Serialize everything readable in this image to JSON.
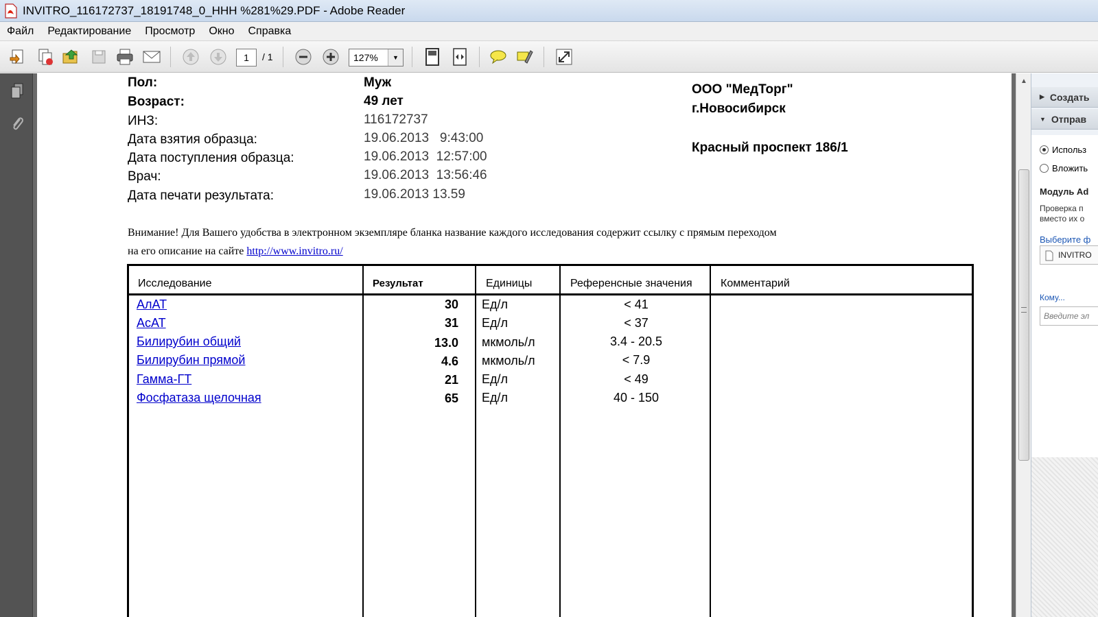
{
  "window": {
    "title": "INVITRO_116172737_18191748_0_HHH %281%29.PDF - Adobe Reader"
  },
  "menu": [
    "Файл",
    "Редактирование",
    "Просмотр",
    "Окно",
    "Справка"
  ],
  "toolbar": {
    "page_current": "1",
    "page_total": "/ 1",
    "zoom": "127%",
    "icons": [
      "create-pdf-icon",
      "combine-icon",
      "open-icon",
      "save-icon",
      "print-icon",
      "email-icon",
      "previous-page-icon",
      "next-page-icon",
      "zoom-out-icon",
      "zoom-in-icon",
      "fit-page-icon",
      "fit-width-icon",
      "comment-icon",
      "highlight-icon",
      "fullscreen-icon"
    ]
  },
  "leftnav": {
    "icons": [
      "pages-icon",
      "attachments-icon"
    ]
  },
  "patient": {
    "sex_label": "Пол:",
    "sex_value": "Муж",
    "age_label": "Возраст:",
    "age_value": "49 лет",
    "inz_label": "ИНЗ:",
    "inz_value": "116172737",
    "sample_date_label": "Дата взятия образца:",
    "sample_date_value": "19.06.2013   9:43:00",
    "received_label": "Дата поступления образца:",
    "received_value": "19.06.2013  12:57:00",
    "doctor_label": "Врач:",
    "doctor_value": "19.06.2013  13:56:46",
    "print_label": "Дата печати результата:",
    "print_value": "19.06.2013 13.59"
  },
  "lab": {
    "name": "ООО \"МедТорг\"",
    "city": "г.Новосибирск",
    "address": "Красный проспект 186/1"
  },
  "notice": {
    "line1": "Внимание! Для Вашего удобства в электронном экземпляре бланка название каждого исследования содержит ссылку с прямым переходом",
    "line2": "на его описание на сайте ",
    "link": "http://www.invitro.ru/"
  },
  "table": {
    "headers": [
      "Исследование",
      "Результат",
      "Единицы",
      "Референсные значения",
      "Комментарий"
    ],
    "rows": [
      {
        "test": "АлАТ",
        "result": "30",
        "unit": "Ед/л",
        "ref": "< 41",
        "comment": ""
      },
      {
        "test": "АсАТ",
        "result": "31",
        "unit": "Ед/л",
        "ref": "< 37",
        "comment": ""
      },
      {
        "test": "Билирубин общий",
        "result": "13.0",
        "unit": "мкмоль/л",
        "ref": "3.4 - 20.5",
        "comment": ""
      },
      {
        "test": "Билирубин прямой",
        "result": "4.6",
        "unit": "мкмоль/л",
        "ref": "< 7.9",
        "comment": ""
      },
      {
        "test": "Гамма-ГТ",
        "result": "21",
        "unit": "Ед/л",
        "ref": "< 49",
        "comment": ""
      },
      {
        "test": "Фосфатаза щелочная",
        "result": "65",
        "unit": "Ед/л",
        "ref": "40 - 150",
        "comment": ""
      }
    ]
  },
  "rightpanel": {
    "create": "Создать",
    "send": "Отправ",
    "radio1": "Использ",
    "radio2": "Вложить",
    "module_title": "Модуль Ad",
    "desc1": "Проверка п",
    "desc2": "вместо их о",
    "choose": "Выберите ф",
    "file": "INVITRO",
    "to": "Кому...",
    "to_placeholder": "Введите эл"
  }
}
